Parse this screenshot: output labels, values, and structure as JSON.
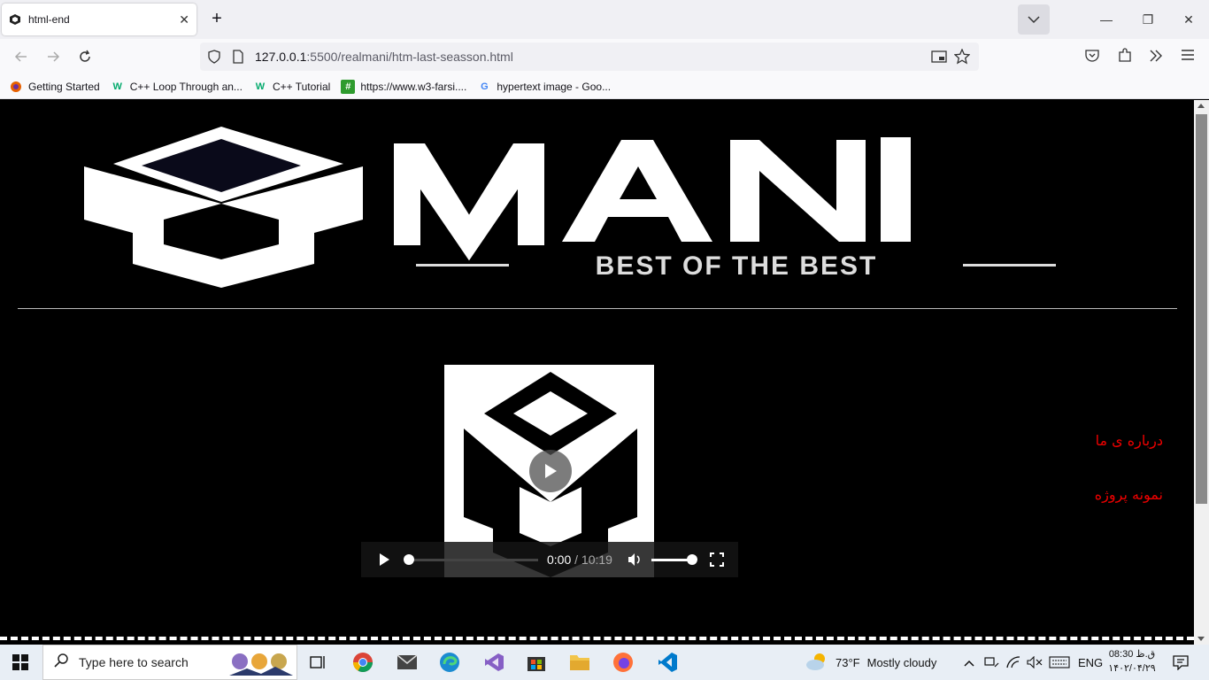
{
  "browser": {
    "tab": {
      "title": "html-end"
    },
    "url": {
      "host": "127.0.0.1",
      "path": ":5500/realmani/htm-last-seasson.html"
    },
    "bookmarks": [
      {
        "label": "Getting Started",
        "icon": "firefox-icon"
      },
      {
        "label": "C++ Loop Through an...",
        "icon": "w3schools-icon"
      },
      {
        "label": "C++ Tutorial",
        "icon": "w3schools-icon"
      },
      {
        "label": "https://www.w3-farsi....",
        "icon": "w3farsi-icon"
      },
      {
        "label": "hypertext image - Goo...",
        "icon": "google-icon"
      }
    ]
  },
  "page": {
    "logo": {
      "name": "MANI",
      "tagline": "BEST OF THE BEST"
    },
    "video": {
      "current_time": "0:00",
      "duration": " / 10:19"
    },
    "links": [
      "درباره ی ما",
      "نمونه پروژه"
    ],
    "colors": {
      "link": "#e00000",
      "background": "#000000"
    }
  },
  "taskbar": {
    "search_placeholder": "Type here to search",
    "weather": {
      "temp": "73°F",
      "condition": "Mostly cloudy"
    },
    "language": "ENG",
    "clock": {
      "time": "08:30 ق.ظ",
      "date": "۱۴۰۲/۰۴/۲۹"
    }
  }
}
